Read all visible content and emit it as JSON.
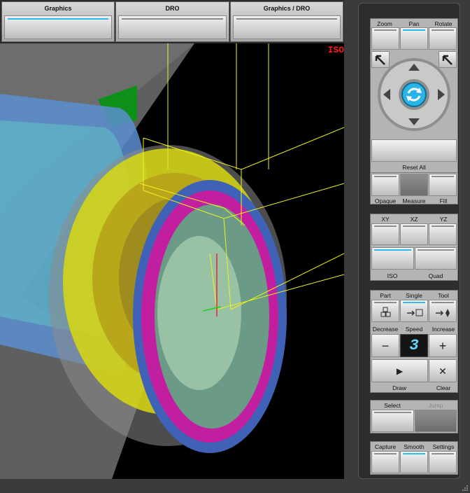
{
  "tabs": [
    {
      "label": "Graphics",
      "active": true
    },
    {
      "label": "DRO",
      "active": false
    },
    {
      "label": "Graphics / DRO",
      "active": false
    }
  ],
  "viewport": {
    "view_label": "ISO"
  },
  "view_group": {
    "zoom": "Zoom",
    "pan": "Pan",
    "rotate": "Rotate",
    "reset_all": "Reset All"
  },
  "display_group": {
    "opaque": "Opaque",
    "measure": "Measure",
    "fill": "Fill"
  },
  "planes_group": {
    "xy": "XY",
    "xz": "XZ",
    "yz": "YZ",
    "iso": "ISO",
    "quad": "Quad"
  },
  "sim_group": {
    "part": "Part",
    "single": "Single",
    "tool": "Tool",
    "decrease": "Decrease",
    "speed": "Speed",
    "increase": "Increase",
    "minus_glyph": "−",
    "plus_glyph": "+",
    "speed_value": "3",
    "play_glyph": "▶",
    "clear_glyph": "✕",
    "draw": "Draw",
    "clear": "Clear"
  },
  "select_group": {
    "select": "Select",
    "jump": "Jump"
  },
  "misc_group": {
    "capture": "Capture",
    "smooth": "Smooth",
    "settings": "Settings"
  },
  "colors": {
    "accent": "#2fb6ea",
    "iso_label": "#ff1b1b",
    "lcd_text": "#5fd6ff"
  }
}
